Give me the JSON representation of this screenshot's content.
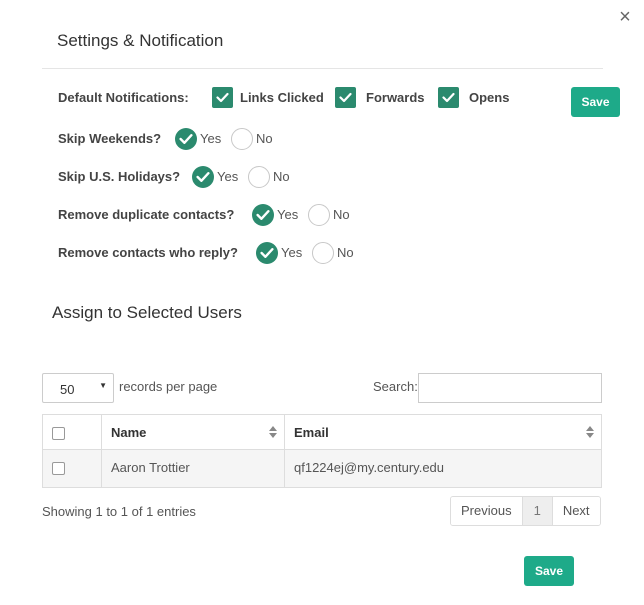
{
  "modal": {
    "close_glyph": "×",
    "title": "Settings & Notification"
  },
  "default_notifications": {
    "label": "Default Notifications:",
    "options": [
      {
        "label": "Links Clicked",
        "checked": true
      },
      {
        "label": "Forwards",
        "checked": true
      },
      {
        "label": "Opens",
        "checked": true
      }
    ],
    "save_label": "Save"
  },
  "settings": [
    {
      "label": "Skip Weekends?",
      "yes": "Yes",
      "no": "No",
      "value": "Yes"
    },
    {
      "label": "Skip U.S. Holidays?",
      "yes": "Yes",
      "no": "No",
      "value": "Yes"
    },
    {
      "label": "Remove duplicate contacts?",
      "yes": "Yes",
      "no": "No",
      "value": "Yes"
    },
    {
      "label": "Remove contacts who reply?",
      "yes": "Yes",
      "no": "No",
      "value": "Yes"
    }
  ],
  "assign": {
    "title": "Assign to Selected Users",
    "page_size": "50",
    "page_size_label": "records per page",
    "search_label": "Search:",
    "search_value": "",
    "columns": [
      "Name",
      "Email"
    ],
    "rows": [
      {
        "name": "Aaron Trottier",
        "email": "qf1224ej@my.century.edu",
        "checked": false
      }
    ],
    "info": "Showing 1 to 1 of 1 entries",
    "pagination": {
      "previous": "Previous",
      "current": "1",
      "next": "Next"
    }
  },
  "footer": {
    "save_label": "Save"
  },
  "colors": {
    "accent": "#2b8a6e",
    "save_button": "#1eaa89"
  },
  "icons": [
    "close-icon",
    "check-icon",
    "sort-icon",
    "chevron-down-icon"
  ]
}
